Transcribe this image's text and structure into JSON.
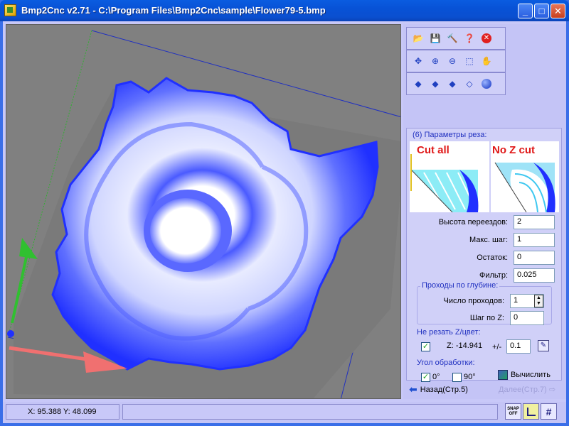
{
  "window": {
    "title": "Bmp2Cnc v2.71 - C:\\Program Files\\Bmp2Cnc\\sample\\Flower79-5.bmp",
    "minimize": "_",
    "maximize": "□",
    "close": "✕"
  },
  "toolbar": {
    "row1": [
      "open-icon",
      "save-icon",
      "tools-icon",
      "help-icon",
      "close-file-icon"
    ],
    "row2": [
      "move-icon",
      "zoom-in-icon",
      "zoom-out-icon",
      "zoom-window-icon",
      "pan-icon"
    ],
    "row3": [
      "view-top-icon",
      "view-front-icon",
      "view-side-icon",
      "view-iso-icon",
      "sphere-icon"
    ]
  },
  "params": {
    "legend": "(6) Параметры реза:",
    "cut_all_label": "Cut all",
    "no_z_cut_label": "No Z cut",
    "travel_height_label": "Высота переездов:",
    "travel_height_value": "2",
    "max_step_label": "Макс. шаг:",
    "max_step_value": "1",
    "remainder_label": "Остаток:",
    "remainder_value": "0",
    "filter_label": "Фильтр:",
    "filter_value": "0.025",
    "depth_passes_legend": "Проходы по глубине:",
    "num_passes_label": "Число проходов:",
    "num_passes_value": "1",
    "z_step_label": "Шаг по Z:",
    "z_step_value": "0",
    "no_cut_legend": "Не резать Z/цвет:",
    "no_cut_checked": true,
    "z_readout": "Z: -14.941",
    "plus_minus_label": "+/-",
    "tolerance_value": "0.1",
    "angle_legend": "Угол обработки:",
    "angle0_label": "0°",
    "angle0_checked": true,
    "angle90_label": "90°",
    "angle90_checked": false,
    "compute_label": "Вычислить"
  },
  "nav": {
    "back_label": "Назад(Стр.5)",
    "next_label": "Далее(Стр.7)"
  },
  "status": {
    "coords": "X: 95.388 Y: 48.099",
    "message": "",
    "snap_label": "SNAP OFF"
  },
  "colors": {
    "accent": "#2030c0",
    "panel_bg": "#c4c4f6",
    "viewport_bg": "#808080",
    "model_blue": "#3040ff"
  }
}
